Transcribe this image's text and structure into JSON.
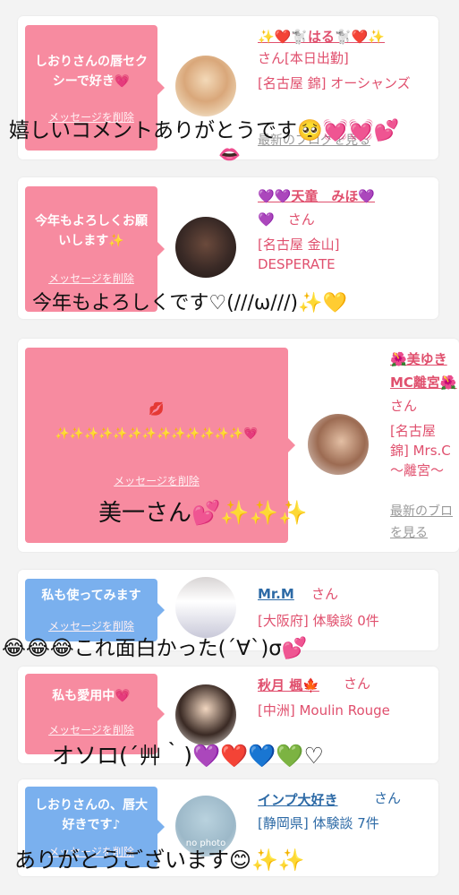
{
  "delete_label": "メッセージを削除",
  "latest_blog": "最新のブログを見る",
  "san": "さん",
  "cards": [
    {
      "bubble": "しおりさんの唇セクシーで好き💗",
      "name": "✨❤️🐩はる🐩❤️✨",
      "name_suffix": "さん[本日出勤]",
      "info": "[名古屋 錦] オーシャンズ",
      "overlay": "嬉しいコメントありがとうです🥺💓💓💕",
      "overlay2": "👄"
    },
    {
      "bubble": "今年もよろしくお願いします✨",
      "name": "💜💜天童　みほ💜",
      "name2": "💜",
      "info": "[名古屋 金山] DESPERATE",
      "overlay": "今年もよろしくです♡(///ω///)✨💛"
    },
    {
      "bubble_top": "💋",
      "bubble": "✨✨✨✨✨✨✨✨✨✨✨✨✨💗",
      "name": "🌺美ゆき",
      "name2": "MC離宮🌺",
      "info": "[名古屋 錦] Mrs.C 〜離宮〜",
      "latest1": "最新のブロ",
      "latest2": "を見る",
      "overlay": "美一さん💕✨✨✨"
    },
    {
      "bubble": "私も使ってみます",
      "name": "Mr.M",
      "info": "[大阪府] 体験談 0件",
      "overlay": "😂😂😂これ面白かった(´∀`)σ💕"
    },
    {
      "bubble": "私も愛用中💗",
      "name": "秋月 楓🍁",
      "info": "[中洲] Moulin Rouge",
      "overlay": "オソロ(´艸｀)💜❤️💙💚♡"
    },
    {
      "bubble": "しおりさんの、唇大好きです♪",
      "name": "インプ大好き",
      "info": "[静岡県] 体験談 7件",
      "avatar_text": "no photo",
      "overlay": "ありがとうございます😊✨✨"
    }
  ]
}
